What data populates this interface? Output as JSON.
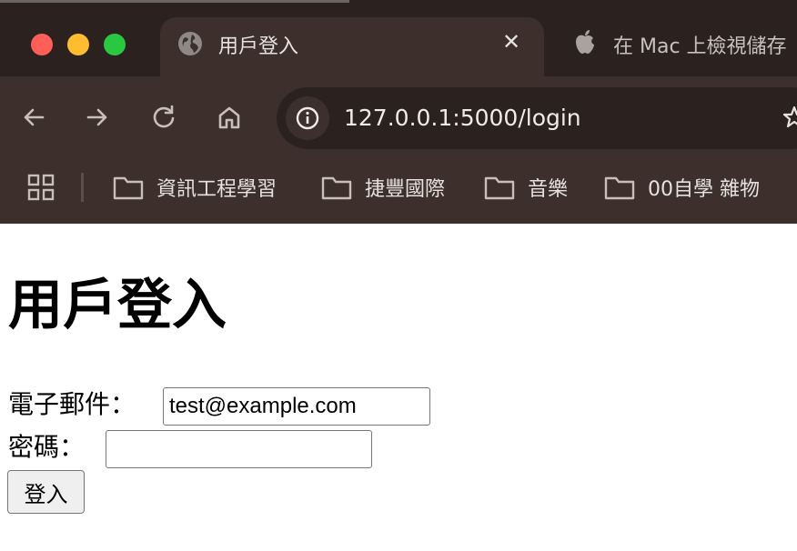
{
  "browser": {
    "active_tab": {
      "title": "用戶登入",
      "icon": "globe-icon",
      "close": "✕"
    },
    "inactive_tab": {
      "title": "在 Mac 上檢視儲存",
      "icon": "apple-icon"
    },
    "url": "127.0.0.1:5000/login",
    "bookmarks": [
      {
        "label": "資訊工程學習",
        "icon": "folder-icon"
      },
      {
        "label": "捷豐國際",
        "icon": "folder-icon"
      },
      {
        "label": "音樂",
        "icon": "folder-icon"
      },
      {
        "label": "00自學 雜物",
        "icon": "folder-icon"
      }
    ]
  },
  "page": {
    "heading": "用戶登入",
    "email_label": "電子郵件：",
    "email_value": "test@example.com",
    "password_label": "密碼：",
    "password_value": "",
    "submit_label": "登入"
  },
  "colors": {
    "chrome_bg": "#3d302c",
    "tabstrip_bg": "#2b2220",
    "traffic_red": "#ff5f57",
    "traffic_yellow": "#febc2e",
    "traffic_green": "#28c840"
  }
}
